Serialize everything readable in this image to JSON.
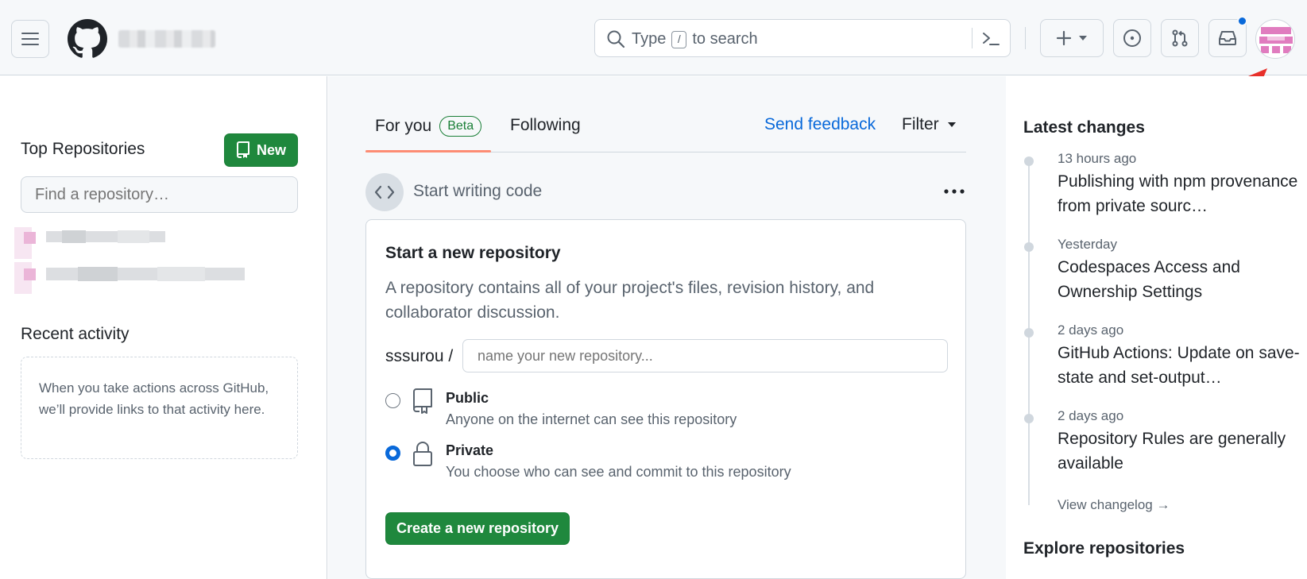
{
  "header": {
    "search_prefix": "Type",
    "search_key": "/",
    "search_suffix": "to search",
    "plus_label": "+"
  },
  "sidebar": {
    "top_repos_title": "Top Repositories",
    "new_button": "New",
    "find_placeholder": "Find a repository…",
    "recent_title": "Recent activity",
    "recent_text": "When you take actions across GitHub, we’ll provide links to that activity here."
  },
  "feed": {
    "tab_for_you": "For you",
    "beta_badge": "Beta",
    "tab_following": "Following",
    "send_feedback": "Send feedback",
    "filter": "Filter",
    "start_writing": "Start writing code",
    "card": {
      "title": "Start a new repository",
      "description": "A repository contains all of your project's files, revision history, and collaborator discussion.",
      "owner": "sssurou /",
      "name_placeholder": "name your new repository...",
      "public_label": "Public",
      "public_desc": "Anyone on the internet can see this repository",
      "private_label": "Private",
      "private_desc": "You choose who can see and commit to this repository",
      "selected_visibility": "Private",
      "create_button": "Create a new repository"
    }
  },
  "changes": {
    "title": "Latest changes",
    "items": [
      {
        "time": "13 hours ago",
        "text": "Publishing with npm provenance from private sourc…"
      },
      {
        "time": "Yesterday",
        "text": "Codespaces Access and Ownership Settings"
      },
      {
        "time": "2 days ago",
        "text": "GitHub Actions: Update on save-state and set-output…"
      },
      {
        "time": "2 days ago",
        "text": "Repository Rules are generally available"
      }
    ],
    "view_changelog": "View changelog →",
    "explore_title": "Explore repositories"
  },
  "colors": {
    "green": "#1f883d",
    "blue": "#0969da",
    "tab_underline": "#fd8c73",
    "annotation_arrow": "#e8302a",
    "avatar_pink": "#e07cbf"
  }
}
